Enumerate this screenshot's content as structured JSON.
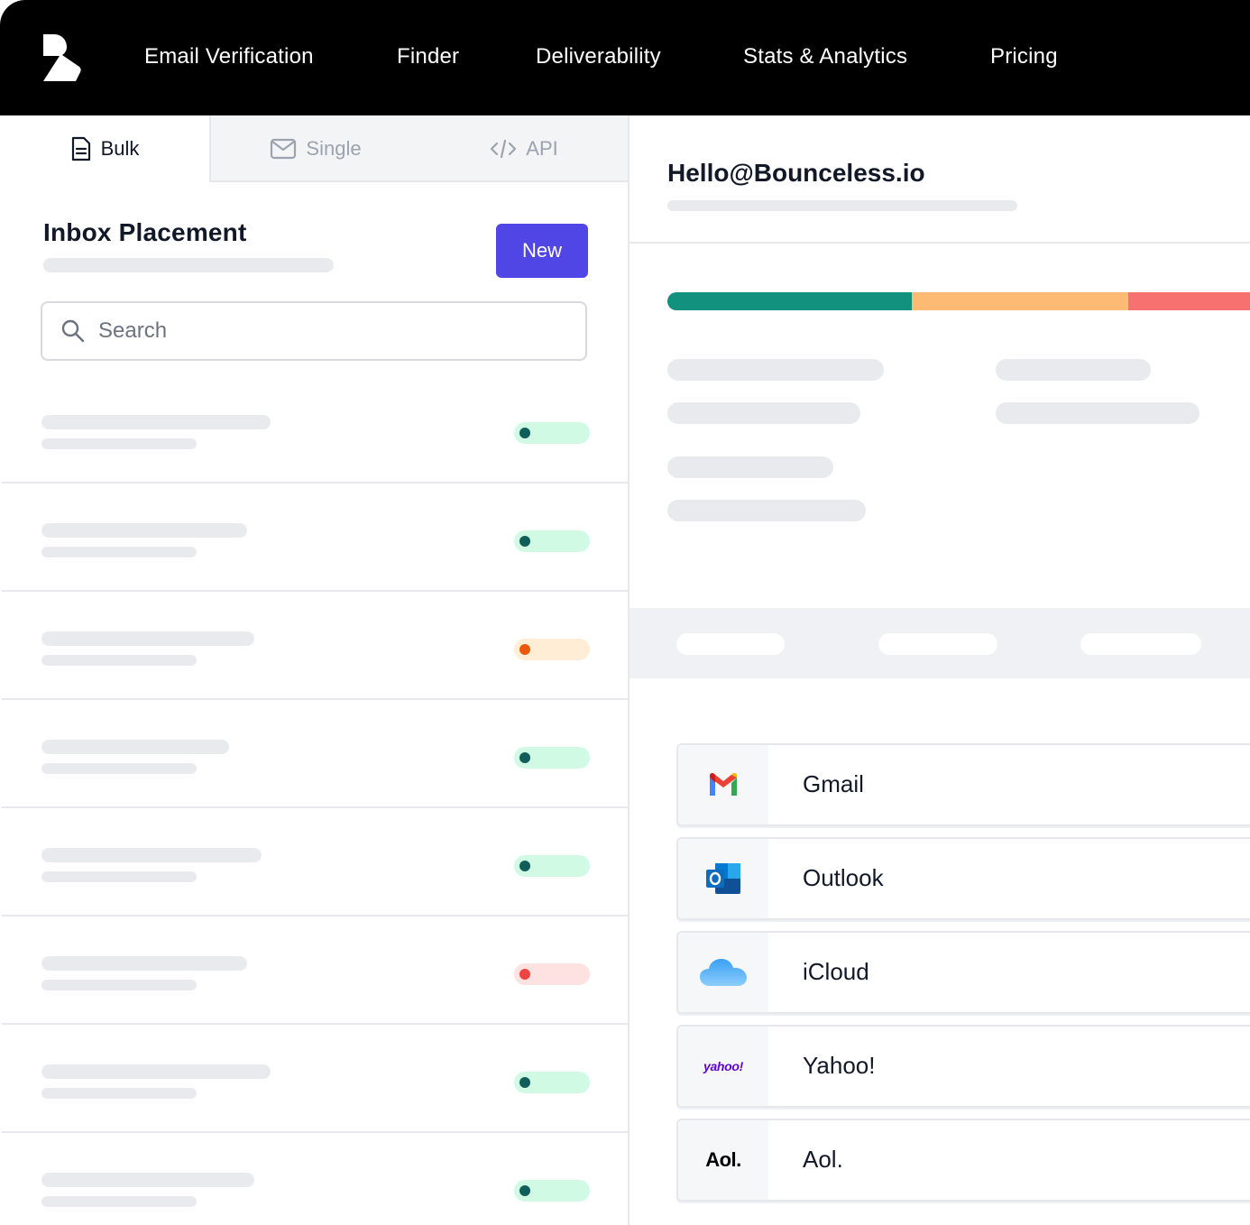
{
  "nav": {
    "logo_icon": "bounceless-logo-icon",
    "items": [
      "Email Verification",
      "Finder",
      "Deliverability",
      "Stats & Analytics",
      "Pricing"
    ]
  },
  "tabs": [
    {
      "label": "Bulk",
      "icon": "document-icon",
      "active": true
    },
    {
      "label": "Single",
      "icon": "envelope-icon",
      "active": false
    },
    {
      "label": "API",
      "icon": "code-icon",
      "active": false
    }
  ],
  "inbox": {
    "title": "Inbox Placement",
    "new_button": "New",
    "search_placeholder": "Search"
  },
  "list": {
    "statuses": [
      "green",
      "green",
      "orange",
      "green",
      "green",
      "red",
      "green",
      "green"
    ]
  },
  "detail": {
    "email": "Hello@Bounceless.io",
    "result_bar": {
      "segments": [
        {
          "status": "good",
          "color": "#13917f"
        },
        {
          "status": "warning",
          "color": "#fdba74"
        },
        {
          "status": "bad",
          "color": "#f87171"
        }
      ]
    }
  },
  "providers": [
    {
      "name": "Gmail",
      "icon": "gmail-icon"
    },
    {
      "name": "Outlook",
      "icon": "outlook-icon"
    },
    {
      "name": "iCloud",
      "icon": "icloud-icon"
    },
    {
      "name": "Yahoo!",
      "icon": "yahoo-icon",
      "logo_text": "yahoo!"
    },
    {
      "name": "Aol.",
      "icon": "aol-icon",
      "logo_text": "Aol."
    }
  ],
  "colors": {
    "brand": "#4f46e5",
    "status_green_dot": "#115e59",
    "status_green_bg": "#d1fae5",
    "status_orange_dot": "#ea580c",
    "status_orange_bg": "#ffedd5",
    "status_red_dot": "#ef4444",
    "status_red_bg": "#fee2e2"
  }
}
